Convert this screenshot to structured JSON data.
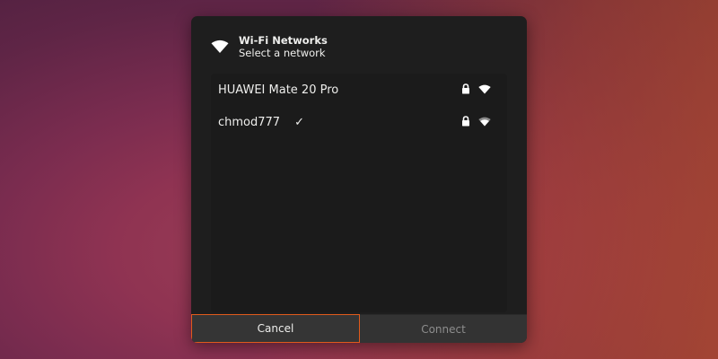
{
  "dialog": {
    "title": "Wi-Fi Networks",
    "subtitle": "Select a network"
  },
  "networks": [
    {
      "ssid": "HUAWEI Mate 20 Pro",
      "connected": false,
      "secured": true,
      "signal_icon": "wifi-signal-full-icon"
    },
    {
      "ssid": "chmod777",
      "connected": true,
      "check": "✓",
      "secured": true,
      "signal_icon": "wifi-signal-good-icon"
    }
  ],
  "buttons": {
    "cancel": "Cancel",
    "connect": "Connect"
  },
  "colors": {
    "dialog_bg": "#1e1e1e",
    "accent": "#e05a1c",
    "disabled_text": "#8d8d8d"
  }
}
